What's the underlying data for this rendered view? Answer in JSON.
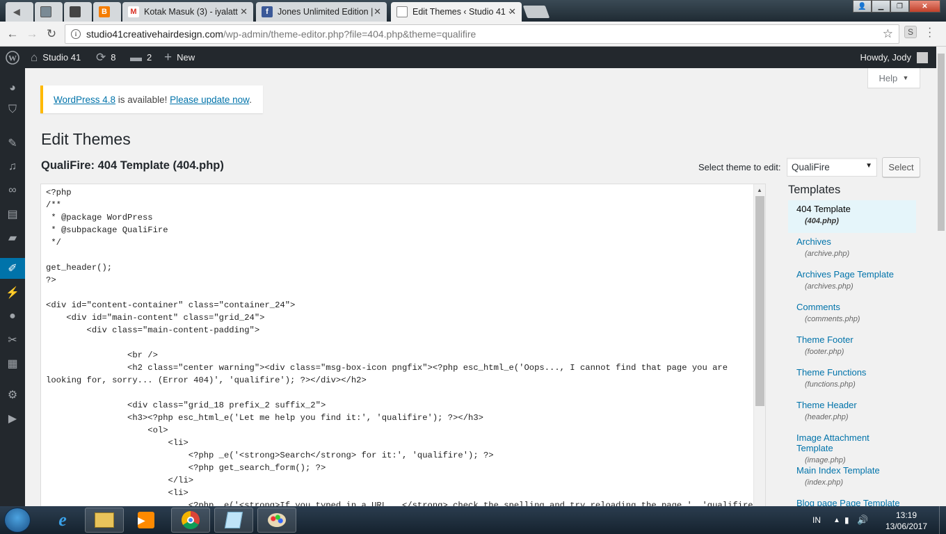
{
  "browser": {
    "tabs": [
      {
        "title": "",
        "icon": "back-arrow-icon"
      },
      {
        "title": "",
        "icon": "whatsapp-icon"
      },
      {
        "title": "",
        "icon": "app-icon"
      },
      {
        "title": "",
        "icon": "blogger-icon"
      },
      {
        "title": "Kotak Masuk (3) - iyalatt",
        "icon": "gmail-icon"
      },
      {
        "title": "Jones Unlimited Edition |",
        "icon": "facebook-icon"
      },
      {
        "title": "Edit Themes ‹ Studio 41 ·",
        "icon": "page-icon"
      }
    ],
    "url_host": "studio41creativehairdesign.com",
    "url_path": "/wp-admin/theme-editor.php?file=404.php&theme=qualifire",
    "extension_label": "S"
  },
  "adminbar": {
    "site_name": "Studio 41",
    "updates_count": "8",
    "comments_count": "2",
    "new_label": "New",
    "howdy": "Howdy, Jody"
  },
  "admin_menu_icons": [
    "dashboard-icon",
    "shield-icon",
    "pin-icon",
    "media-icon",
    "links-icon",
    "pages-icon",
    "comments-icon",
    "appearance-icon",
    "plugins-icon",
    "users-icon",
    "tools-icon",
    "grid-icon",
    "settings-icon",
    "play-icon"
  ],
  "help_label": "Help",
  "notice": {
    "link1": "WordPress 4.8",
    "middle": " is available! ",
    "link2": "Please update now",
    "end": "."
  },
  "page_title": "Edit Themes",
  "file_title": "QualiFire: 404 Template (404.php)",
  "theme_select": {
    "label": "Select theme to edit:",
    "value": "QualiFire",
    "button": "Select"
  },
  "code_lines": [
    "<?php",
    "/**",
    " * @package WordPress",
    " * @subpackage QualiFire",
    " */",
    "",
    "get_header();",
    "?>",
    "",
    "<div id=\"content-container\" class=\"container_24\">",
    "    <div id=\"main-content\" class=\"grid_24\">",
    "        <div class=\"main-content-padding\">",
    "",
    "                <br />",
    "                <h2 class=\"center warning\"><div class=\"msg-box-icon pngfix\"><?php esc_html_e('Oops..., I cannot find that page you are",
    "looking for, sorry... (Error 404)', 'qualifire'); ?></div></h2>",
    "",
    "                <div class=\"grid_18 prefix_2 suffix_2\">",
    "                <h3><?php esc_html_e('Let me help you find it:', 'qualifire'); ?></h3>",
    "                    <ol>",
    "                        <li>",
    "                            <?php _e('<strong>Search</strong> for it:', 'qualifire'); ?>",
    "                            <?php get_search_form(); ?>",
    "                        </li>",
    "                        <li>",
    "                            <?php _e('<strong>If you typed in a URL...</strong> check the spelling and try reloading the page.', 'qualifire'"
  ],
  "templates": {
    "heading": "Templates",
    "items": [
      {
        "name": "404 Template",
        "file": "(404.php)"
      },
      {
        "name": "Archives",
        "file": "(archive.php)"
      },
      {
        "name": "Archives Page Template",
        "file": "(archives.php)"
      },
      {
        "name": "Comments",
        "file": "(comments.php)"
      },
      {
        "name": "Theme Footer",
        "file": "(footer.php)"
      },
      {
        "name": "Theme Functions",
        "file": "(functions.php)"
      },
      {
        "name": "Theme Header",
        "file": "(header.php)"
      },
      {
        "name": "Image Attachment Template",
        "file": "(image.php)"
      },
      {
        "name": "Main Index Template",
        "file": "(index.php)"
      },
      {
        "name": "Blog page Page Template",
        "file": ""
      }
    ]
  },
  "taskbar": {
    "apps": [
      "ie-icon",
      "explorer-icon",
      "media-player-icon",
      "chrome-icon",
      "notepad-icon",
      "paint-icon"
    ],
    "language": "IN",
    "time": "13:19",
    "date": "13/06/2017"
  },
  "colors": {
    "admin_dark": "#23282d",
    "wp_blue": "#0073aa",
    "notice_yellow": "#ffb900"
  }
}
